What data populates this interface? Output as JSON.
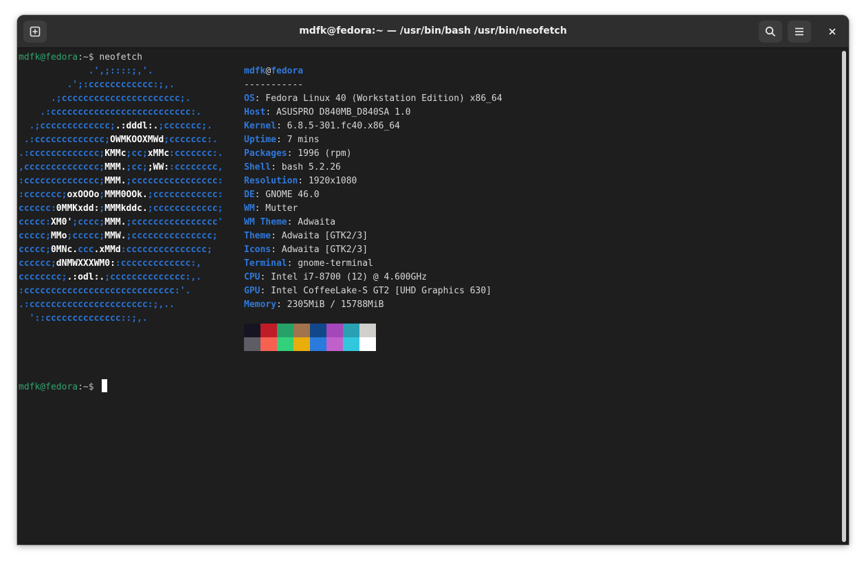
{
  "window": {
    "title": "mdfk@fedora:~ — /usr/bin/bash /usr/bin/neofetch",
    "new_tab_icon": "new-tab-icon",
    "search_icon": "search-icon",
    "menu_icon": "hamburger-menu-icon",
    "close_icon": "close-icon"
  },
  "prompt1": {
    "user_host": "mdfk@fedora",
    "path": ":~$",
    "command": " neofetch"
  },
  "logo": {
    "lines": [
      [
        [
          "             .',;::::;,'.",
          0
        ]
      ],
      [
        [
          "         .';:cccccccccccc:;,.",
          0
        ]
      ],
      [
        [
          "      .;cccccccccccccccccccccc;.",
          0
        ]
      ],
      [
        [
          "    .:cccccccccccccccccccccccccc:.",
          0
        ]
      ],
      [
        [
          "  .;ccccccccccccc;",
          0
        ],
        [
          ".:dddl:.",
          1
        ],
        [
          ";ccccccc;.",
          0
        ]
      ],
      [
        [
          " .:ccccccccccccc;",
          0
        ],
        [
          "OWMKOOXMWd",
          1
        ],
        [
          ";ccccccc:.",
          0
        ]
      ],
      [
        [
          ".:ccccccccccccc;",
          0
        ],
        [
          "KMMc",
          1
        ],
        [
          ";cc;",
          0
        ],
        [
          "xMMc",
          1
        ],
        [
          ":ccccccc:.",
          0
        ]
      ],
      [
        [
          ",cccccccccccccc;",
          0
        ],
        [
          "MMM.",
          1
        ],
        [
          ";cc;",
          0
        ],
        [
          ";WW:",
          1
        ],
        [
          ":cccccccc,",
          0
        ]
      ],
      [
        [
          ":cccccccccccccc;",
          0
        ],
        [
          "MMM.",
          1
        ],
        [
          ";cccccccccccccccc:",
          0
        ]
      ],
      [
        [
          ":ccccccc;",
          0
        ],
        [
          "oxOOOo",
          1
        ],
        [
          ";",
          0
        ],
        [
          "MMM0OOk.",
          1
        ],
        [
          ";cccccccccccc:",
          0
        ]
      ],
      [
        [
          "cccccc:",
          0
        ],
        [
          "0MMKxdd:",
          1
        ],
        [
          ";",
          0
        ],
        [
          "MMMkddc.",
          1
        ],
        [
          ";cccccccccccc;",
          0
        ]
      ],
      [
        [
          "ccccc:",
          0
        ],
        [
          "XM0'",
          1
        ],
        [
          ";cccc;",
          0
        ],
        [
          "MMM.",
          1
        ],
        [
          ";cccccccccccccccc'",
          0
        ]
      ],
      [
        [
          "ccccc;",
          0
        ],
        [
          "MMo",
          1
        ],
        [
          ";ccccc;",
          0
        ],
        [
          "MMW.",
          1
        ],
        [
          ";ccccccccccccccc;",
          0
        ]
      ],
      [
        [
          "ccccc;",
          0
        ],
        [
          "0MNc.",
          1
        ],
        [
          "ccc",
          0
        ],
        [
          ".xMMd",
          1
        ],
        [
          ":ccccccccccccccc;",
          0
        ]
      ],
      [
        [
          "cccccc;",
          0
        ],
        [
          "dNMWXXXWM0:",
          1
        ],
        [
          ":ccccccccccccc:,",
          0
        ]
      ],
      [
        [
          "cccccccc;",
          0
        ],
        [
          ".:odl:.",
          1
        ],
        [
          ";cccccccccccccc:,.",
          0
        ]
      ],
      [
        [
          ":cccccccccccccccccccccccccccc:'.",
          0
        ]
      ],
      [
        [
          ".:cccccccccccccccccccccc:;,..",
          0
        ]
      ],
      [
        [
          "  '::cccccccccccccc::;,.",
          0
        ]
      ]
    ]
  },
  "info": {
    "user": "mdfk",
    "at": "@",
    "host": "fedora",
    "separator": "-----------",
    "rows": [
      {
        "label": "OS",
        "value": ": Fedora Linux 40 (Workstation Edition) x86_64"
      },
      {
        "label": "Host",
        "value": ": ASUSPRO D840MB_D840SA 1.0"
      },
      {
        "label": "Kernel",
        "value": ": 6.8.5-301.fc40.x86_64"
      },
      {
        "label": "Uptime",
        "value": ": 7 mins"
      },
      {
        "label": "Packages",
        "value": ": 1996 (rpm)"
      },
      {
        "label": "Shell",
        "value": ": bash 5.2.26"
      },
      {
        "label": "Resolution",
        "value": ": 1920x1080"
      },
      {
        "label": "DE",
        "value": ": GNOME 46.0"
      },
      {
        "label": "WM",
        "value": ": Mutter"
      },
      {
        "label": "WM Theme",
        "value": ": Adwaita"
      },
      {
        "label": "Theme",
        "value": ": Adwaita [GTK2/3]"
      },
      {
        "label": "Icons",
        "value": ": Adwaita [GTK2/3]"
      },
      {
        "label": "Terminal",
        "value": ": gnome-terminal"
      },
      {
        "label": "CPU",
        "value": ": Intel i7-8700 (12) @ 4.600GHz"
      },
      {
        "label": "GPU",
        "value": ": Intel CoffeeLake-S GT2 [UHD Graphics 630]"
      },
      {
        "label": "Memory",
        "value": ": 2305MiB / 15788MiB"
      }
    ]
  },
  "palette": {
    "normal": [
      "#171421",
      "#c01c28",
      "#26a269",
      "#a2734c",
      "#12488b",
      "#a347ba",
      "#2aa1b3",
      "#d0cfcc"
    ],
    "bright": [
      "#5e5c64",
      "#f66151",
      "#33d17a",
      "#e9ad0c",
      "#2a7bde",
      "#c061cb",
      "#33c7de",
      "#ffffff"
    ]
  },
  "prompt2": {
    "user_host": "mdfk@fedora",
    "path": ":~$",
    "command": " "
  }
}
